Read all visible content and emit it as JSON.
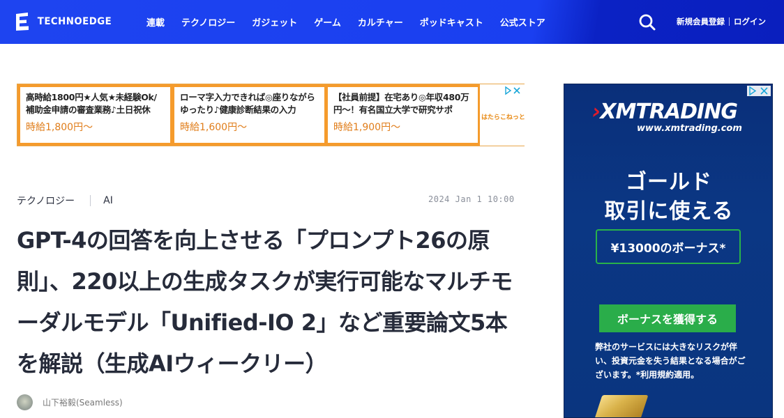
{
  "header": {
    "logo_text": "TECHNOEDGE",
    "nav": [
      "連載",
      "テクノロジー",
      "ガジェット",
      "ゲーム",
      "カルチャー",
      "ポッドキャスト",
      "公式ストア"
    ],
    "register": "新規会員登録",
    "login": "ログイン",
    "bg_color": "#1a3ff0"
  },
  "top_ad": {
    "cards": [
      {
        "text": "高時給1800円★人気★未経験Ok/補助金申請の審査業務♪土日祝休",
        "price": "時給1,800円〜"
      },
      {
        "text": "ローマ字入力できれば◎座りながらゆったり♪健康診断結果の入力",
        "price": "時給1,600円〜"
      },
      {
        "text": "【社員前提】在宅あり◎年収480万円〜！有名国立大学で研究サポ",
        "price": "時給1,900円〜"
      }
    ],
    "brand": "はたらこねっと",
    "border_color": "#f59b2c"
  },
  "article": {
    "category": "テクノロジー",
    "tag": "AI",
    "date": "2024 Jan 1 10:00",
    "title": "GPT-4の回答を向上させる「プロンプト26の原則」、220以上の生成タスクが実行可能なマルチモーダルモデル「Unified-IO 2」など重要論文5本を解説（生成AIウィークリー）",
    "author": "山下裕毅(Seamless)"
  },
  "side_ad": {
    "logo": "XMTRADING",
    "url": "www.xmtrading.com",
    "headline_line1": "ゴールド",
    "headline_line2": "取引に使える",
    "bonus": "¥13000のボーナス*",
    "cta": "ボーナスを獲得する",
    "disclaimer": "弊社のサービスには大きなリスクが伴い、投資元金を失う結果となる場合がございます。*利用規約適用。"
  }
}
